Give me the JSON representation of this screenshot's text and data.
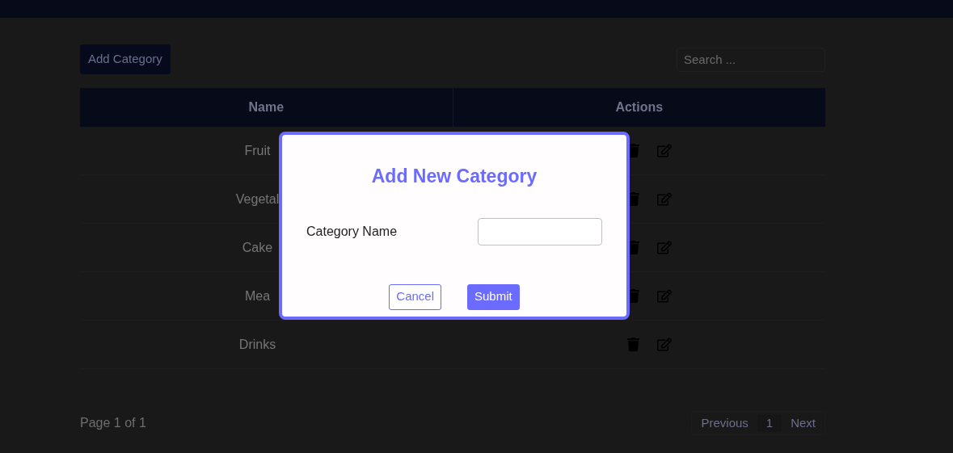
{
  "toolbar": {
    "add_button": "Add Category",
    "search": {
      "placeholder": "Search ..."
    }
  },
  "table": {
    "columns": [
      "Name",
      "Actions"
    ],
    "rows": [
      {
        "name": "Fruit"
      },
      {
        "name": "Vegetal"
      },
      {
        "name": "Cake"
      },
      {
        "name": "Mea"
      },
      {
        "name": "Drinks"
      }
    ]
  },
  "pagination": {
    "summary": "Page 1 of 1",
    "previous": "Previous",
    "pages": [
      {
        "label": "1",
        "selected": true
      }
    ],
    "next": "Next"
  },
  "dialog": {
    "title": "Add New Category",
    "field_label": "Category Name",
    "buttons": [
      {
        "label": "Cancel",
        "kind": "secondary"
      },
      {
        "label": "Submit",
        "kind": "primary"
      }
    ]
  }
}
